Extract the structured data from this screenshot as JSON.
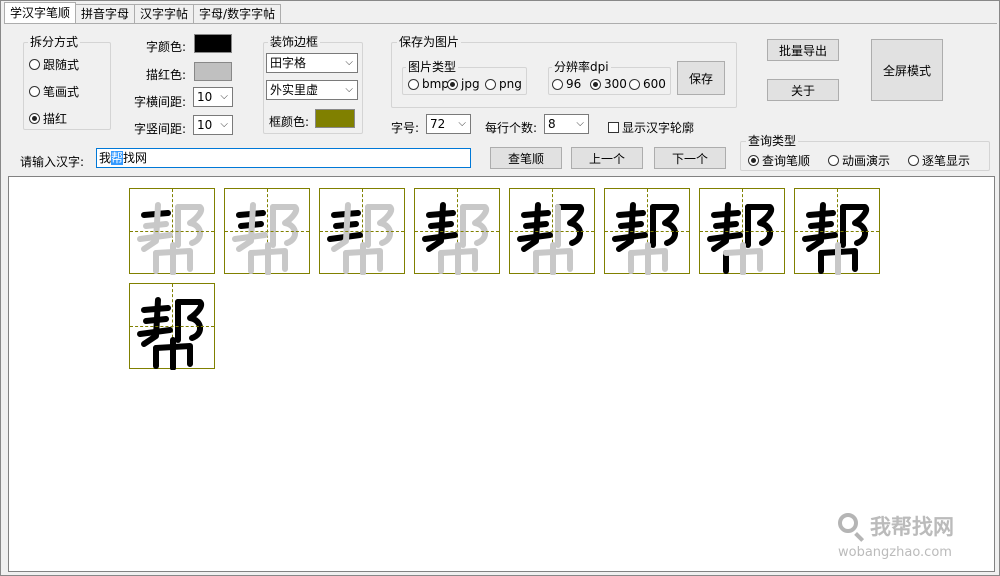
{
  "tabs": [
    "学汉字笔顺",
    "拼音字母",
    "汉字字帖",
    "字母/数字字帖"
  ],
  "split": {
    "title": "拆分方式",
    "options": [
      "跟随式",
      "笔画式",
      "描红"
    ],
    "selected": 2
  },
  "colors": {
    "char_label": "字颜色:",
    "char_color": "#000000",
    "trace_label": "描红色:",
    "trace_color": "#c0c0c0",
    "frame_label": "框颜色:",
    "frame_color": "#808000"
  },
  "spacing": {
    "h_label": "字横间距:",
    "h_value": "10",
    "v_label": "字竖间距:",
    "v_value": "10"
  },
  "border": {
    "title": "装饰边框",
    "grid_value": "田字格",
    "style_value": "外实里虚"
  },
  "save_image": {
    "title": "保存为图片",
    "type_title": "图片类型",
    "types": [
      "bmp",
      "jpg",
      "png"
    ],
    "type_selected": 1,
    "dpi_title": "分辨率dpi",
    "dpis": [
      "96",
      "300",
      "600"
    ],
    "dpi_selected": 1,
    "save_label": "保存"
  },
  "size": {
    "label": "字号:",
    "value": "72"
  },
  "per_row": {
    "label": "每行个数:",
    "value": "8"
  },
  "outline_label": "显示汉字轮廓",
  "buttons": {
    "batch_export": "批量导出",
    "about": "关于",
    "fullscreen": "全屏模式",
    "lookup": "查笔顺",
    "prev": "上一个",
    "next": "下一个"
  },
  "input": {
    "label": "请输入汉字:",
    "before": "我",
    "highlight": "帮",
    "after": "找网"
  },
  "query": {
    "title": "查询类型",
    "options": [
      "查询笔顺",
      "动画演示",
      "逐笔显示"
    ],
    "selected": 0
  },
  "canvas": {
    "character": "帮",
    "stroke_total": 9,
    "ink_color": "#000000",
    "trace_color": "#c8c8c8",
    "cells_per_row": 8
  },
  "watermark": {
    "name": "我帮找网",
    "domain": "wobangzhao.com"
  }
}
